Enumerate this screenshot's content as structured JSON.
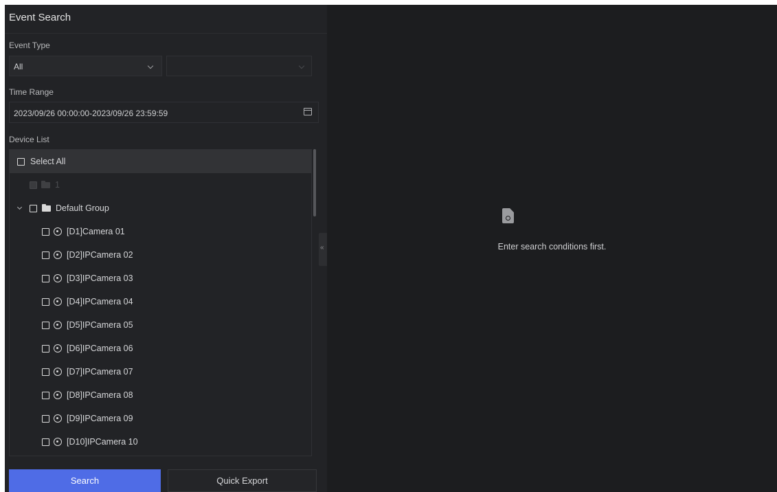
{
  "panel": {
    "title": "Event Search",
    "event_type": {
      "label": "Event Type",
      "primary_value": "All",
      "secondary_value": ""
    },
    "time_range": {
      "label": "Time Range",
      "value": "2023/09/26 00:00:00-2023/09/26 23:59:59",
      "icon": "calendar-icon"
    },
    "device_list": {
      "label": "Device List",
      "select_all": "Select All",
      "disabled_group": "1",
      "group": "Default Group",
      "cameras": [
        "[D1]Camera 01",
        "[D2]IPCamera 02",
        "[D3]IPCamera 03",
        "[D4]IPCamera 04",
        "[D5]IPCamera 05",
        "[D6]IPCamera 06",
        "[D7]IPCamera 07",
        "[D8]IPCamera 08",
        "[D9]IPCamera 09",
        "[D10]IPCamera 10"
      ]
    },
    "buttons": {
      "search": "Search",
      "quick_export": "Quick Export"
    },
    "collapse_glyph": "«"
  },
  "results": {
    "empty_icon": "search-document-icon",
    "empty_message": "Enter search conditions first."
  },
  "colors": {
    "accent": "#4f6ce6",
    "background": "#1e1f21"
  }
}
